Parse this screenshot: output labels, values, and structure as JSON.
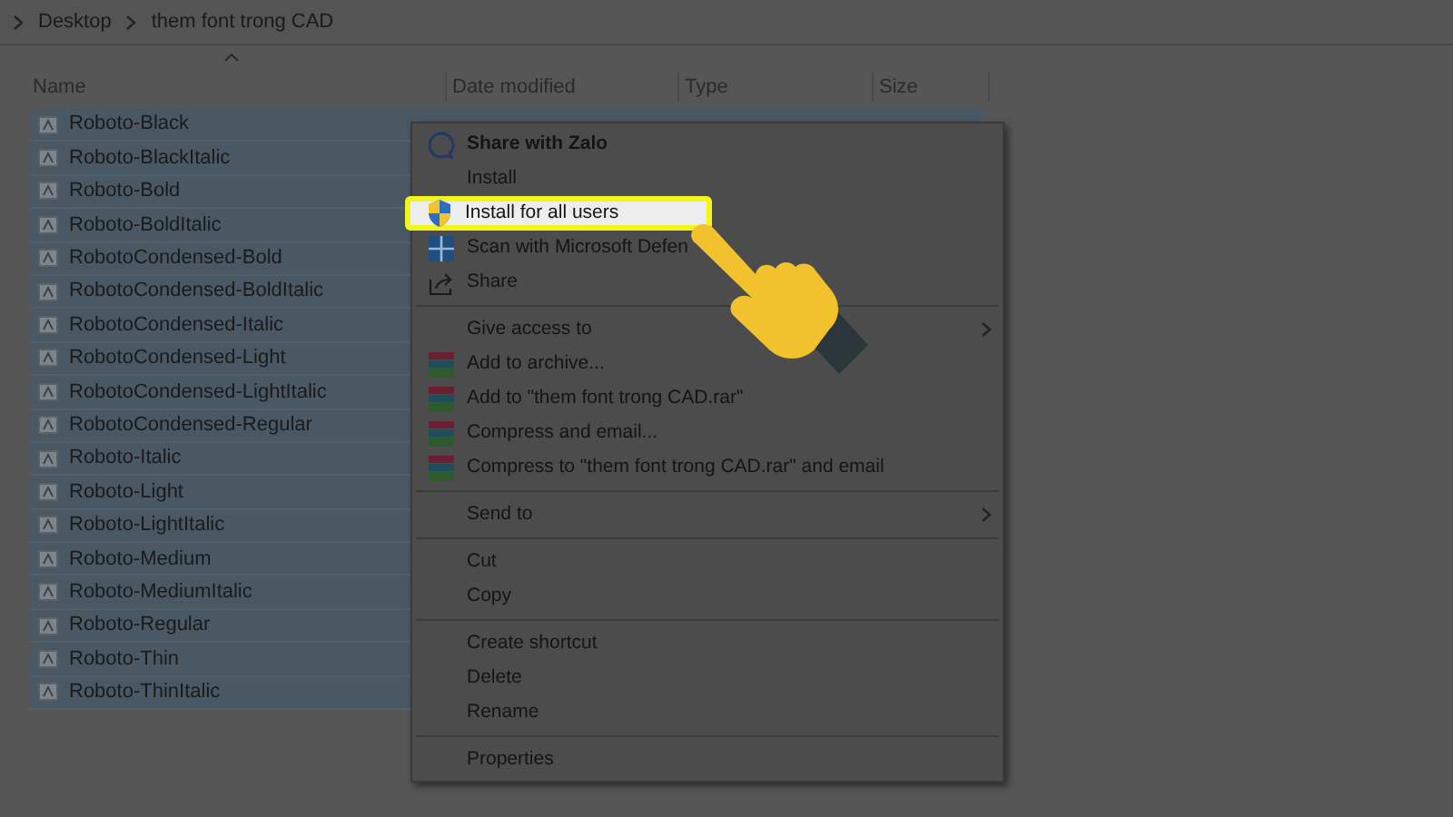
{
  "breadcrumb": [
    {
      "label": "Desktop"
    },
    {
      "label": "them font trong CAD"
    }
  ],
  "columns": [
    "Name",
    "Date modified",
    "Type",
    "Size"
  ],
  "files": [
    {
      "name": "Roboto-Black",
      "selected": true
    },
    {
      "name": "Roboto-BlackItalic",
      "selected": true
    },
    {
      "name": "Roboto-Bold",
      "selected": true
    },
    {
      "name": "Roboto-BoldItalic",
      "selected": true
    },
    {
      "name": "RobotoCondensed-Bold",
      "selected": true
    },
    {
      "name": "RobotoCondensed-BoldItalic",
      "selected": true
    },
    {
      "name": "RobotoCondensed-Italic",
      "selected": true
    },
    {
      "name": "RobotoCondensed-Light",
      "selected": true
    },
    {
      "name": "RobotoCondensed-LightItalic",
      "selected": true
    },
    {
      "name": "RobotoCondensed-Regular",
      "selected": true
    },
    {
      "name": "Roboto-Italic",
      "selected": true
    },
    {
      "name": "Roboto-Light",
      "selected": true
    },
    {
      "name": "Roboto-LightItalic",
      "selected": true
    },
    {
      "name": "Roboto-Medium",
      "selected": true
    },
    {
      "name": "Roboto-MediumItalic",
      "selected": true
    },
    {
      "name": "Roboto-Regular",
      "selected": true
    },
    {
      "name": "Roboto-Thin",
      "selected": true
    },
    {
      "name": "Roboto-ThinItalic",
      "selected": true
    }
  ],
  "context_menu": {
    "items": [
      {
        "kind": "app",
        "label": "Share with Zalo",
        "highlighted": false
      },
      {
        "kind": "plain",
        "label": "Install",
        "highlighted": false
      },
      {
        "kind": "admin",
        "label": "Install for all users",
        "highlighted": true
      },
      {
        "kind": "scan",
        "label": "Scan with Microsoft Defen",
        "highlighted": false
      },
      {
        "kind": "share",
        "label": "Share",
        "highlighted": false
      },
      {
        "kind": "separator"
      },
      {
        "kind": "submenu",
        "label": "Give access to",
        "highlighted": false
      },
      {
        "kind": "archive",
        "label": "Add to archive...",
        "highlighted": false
      },
      {
        "kind": "archive",
        "label": "Add to \"them font trong CAD.rar\"",
        "highlighted": false
      },
      {
        "kind": "archive",
        "label": "Compress and email...",
        "highlighted": false
      },
      {
        "kind": "archive",
        "label": "Compress to \"them font trong CAD.rar\" and email",
        "highlighted": false
      },
      {
        "kind": "separator"
      },
      {
        "kind": "submenu",
        "label": "Send to",
        "highlighted": false
      },
      {
        "kind": "separator"
      },
      {
        "kind": "plain",
        "label": "Cut",
        "highlighted": false
      },
      {
        "kind": "plain",
        "label": "Copy",
        "highlighted": false
      },
      {
        "kind": "separator"
      },
      {
        "kind": "plain",
        "label": "Create shortcut",
        "highlighted": false
      },
      {
        "kind": "plain",
        "label": "Delete",
        "highlighted": false
      },
      {
        "kind": "plain",
        "label": "Rename",
        "highlighted": false
      },
      {
        "kind": "separator"
      },
      {
        "kind": "plain",
        "label": "Properties",
        "highlighted": false
      }
    ]
  }
}
